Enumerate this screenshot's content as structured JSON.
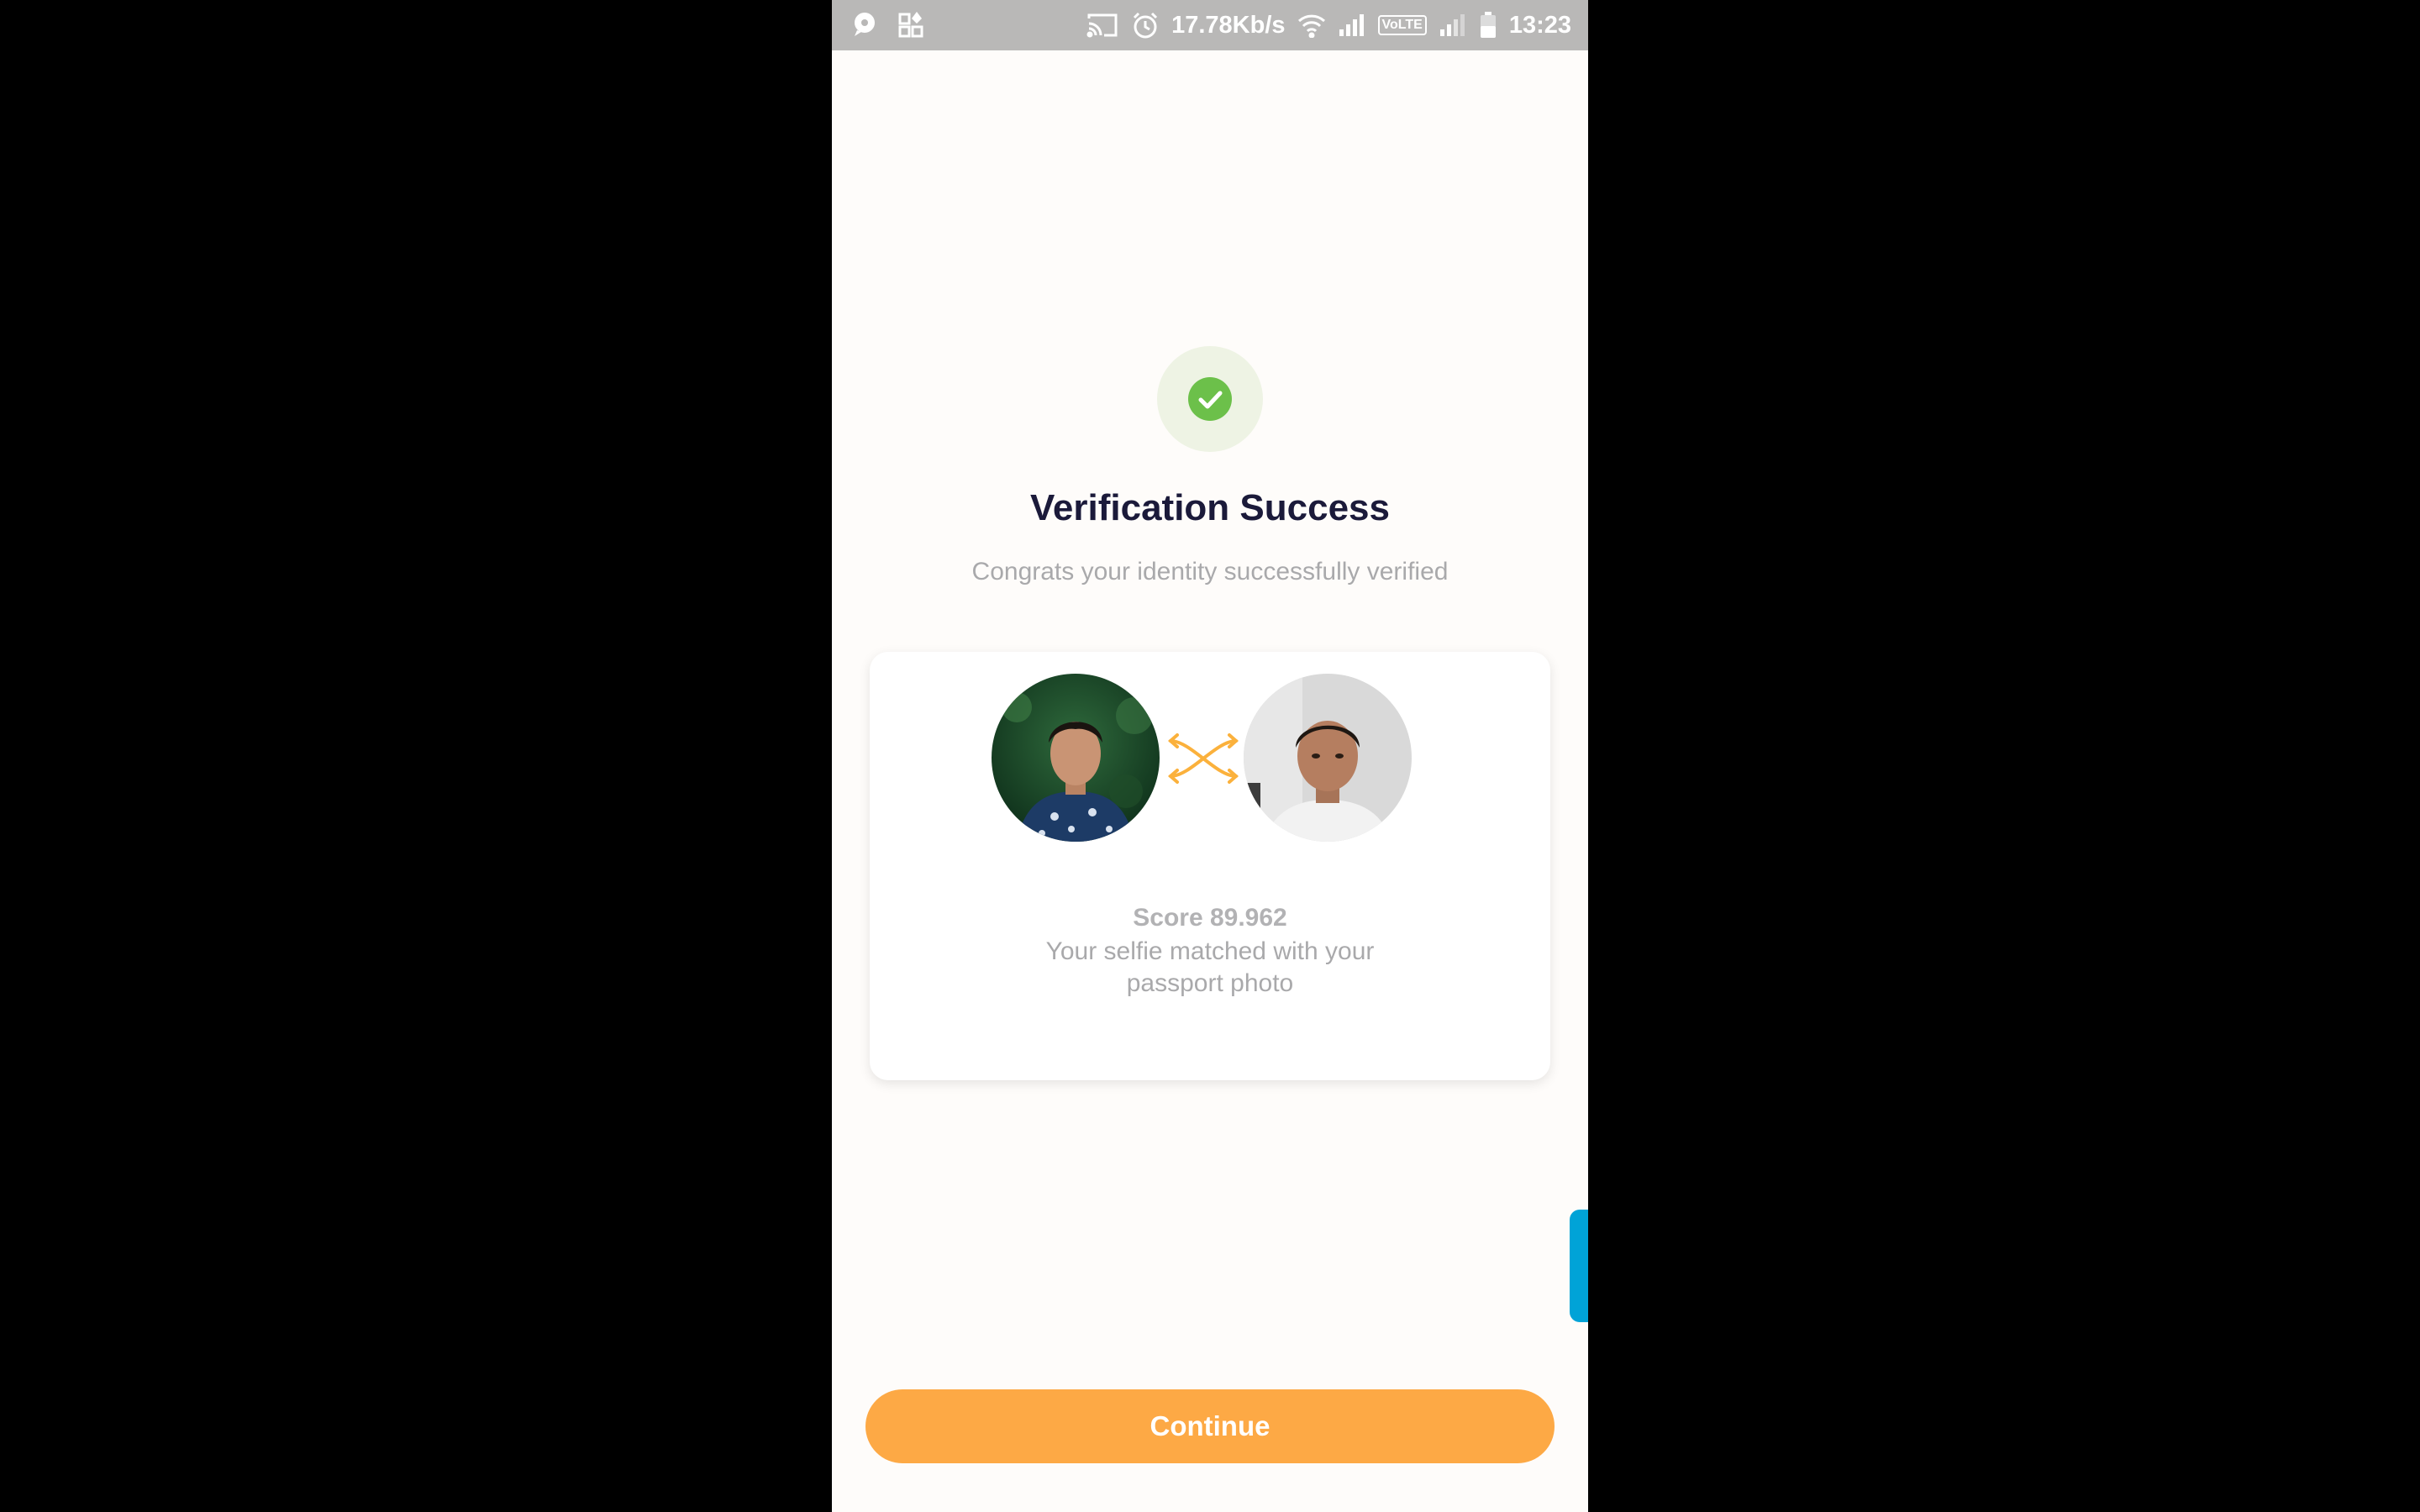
{
  "status_bar": {
    "network_speed": "17.78Kb/s",
    "volte_badge": "VoLTE",
    "time": "13:23",
    "left_icons": [
      "chat-bubble-icon",
      "apps-icon"
    ],
    "right_icons": [
      "cast-icon",
      "alarm-icon",
      "wifi-icon",
      "signal-icon",
      "battery-icon"
    ]
  },
  "header": {
    "status_icon": "check-circle-icon",
    "title": "Verification Success",
    "subtitle": "Congrats your identity successfully verified"
  },
  "match_card": {
    "passport_photo_icon": "passport-photo",
    "compare_icon": "swap-arrows-icon",
    "selfie_photo_icon": "selfie-photo",
    "score": "Score 89.962",
    "message_line1": "Your selfie matched with your",
    "message_line2": "passport photo"
  },
  "actions": {
    "continue_label": "Continue"
  },
  "colors": {
    "accent": "#fda945",
    "success": "#6cc04a",
    "title": "#1b1a3a",
    "handle": "#00a3d7"
  }
}
